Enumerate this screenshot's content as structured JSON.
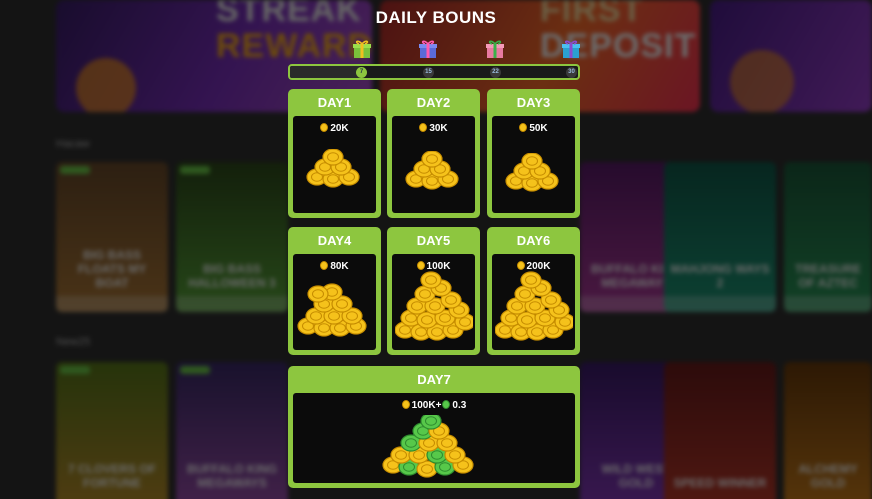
{
  "background": {
    "banners": [
      {
        "lines": [
          "STREAK",
          "REWARDS"
        ]
      },
      {
        "lines": [
          "FIRST",
          "DEPOSIT"
        ]
      }
    ],
    "rows": [
      {
        "label": "Hacaw",
        "tiles": [
          "BIG BASS FLOATS MY BOAT",
          "BIG BASS HALLOWEEN 3",
          "BUFFALO KING MEGAWAYS",
          "MAHJONG WAYS 2",
          "TREASURE OF AZTEC"
        ]
      },
      {
        "label": "New25",
        "tiles": [
          "7 CLOVERS OF FORTUNE",
          "BUFFALO KING MEGAWAYS",
          "WILD WEST GOLD",
          "SPEED WINNER",
          "ALCHEMY GOLD"
        ]
      }
    ]
  },
  "modal": {
    "title": "DAILY BOUNS",
    "milestones": [
      {
        "label": "7",
        "active": true
      },
      {
        "label": "15",
        "active": false
      },
      {
        "label": "22",
        "active": false
      },
      {
        "label": "30",
        "active": false
      }
    ],
    "days": [
      {
        "title": "DAY1",
        "reward": "20K"
      },
      {
        "title": "DAY2",
        "reward": "30K"
      },
      {
        "title": "DAY3",
        "reward": "50K"
      },
      {
        "title": "DAY4",
        "reward": "80K"
      },
      {
        "title": "DAY5",
        "reward": "100K"
      },
      {
        "title": "DAY6",
        "reward": "200K"
      },
      {
        "title": "DAY7",
        "reward": "100K+",
        "reward_extra": "0.3"
      }
    ]
  },
  "colors": {
    "accent_green": "#8dc63f",
    "coin_gold": "#f5c21b",
    "gem_green": "#57c84a",
    "card_inner": "#0b0b0b"
  },
  "icons": {
    "gift": "gift-box-icon",
    "coin": "gold-coin-icon",
    "gem": "green-coin-icon"
  }
}
